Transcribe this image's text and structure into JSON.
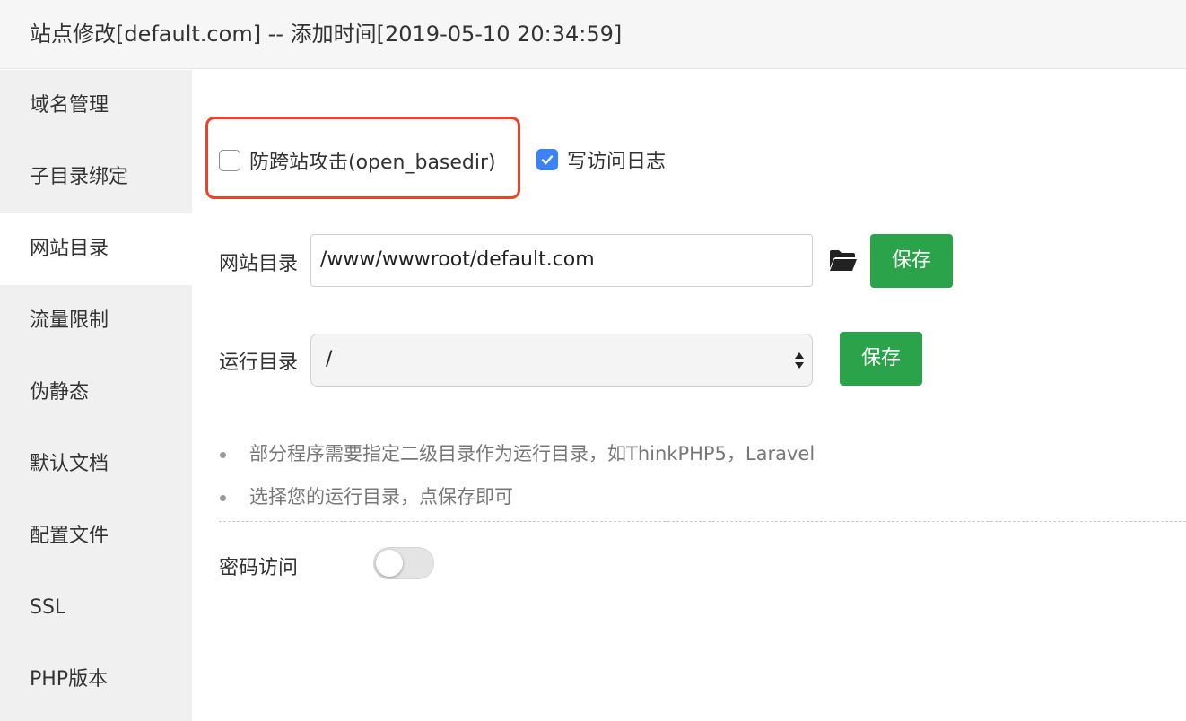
{
  "window": {
    "title": "站点修改[default.com] -- 添加时间[2019-05-10 20:34:59]"
  },
  "sidebar": {
    "items": [
      {
        "label": "域名管理"
      },
      {
        "label": "子目录绑定"
      },
      {
        "label": "网站目录",
        "active": true
      },
      {
        "label": "流量限制"
      },
      {
        "label": "伪静态"
      },
      {
        "label": "默认文档"
      },
      {
        "label": "配置文件"
      },
      {
        "label": "SSL"
      },
      {
        "label": "PHP版本"
      }
    ]
  },
  "main": {
    "anti_xss": {
      "label": "防跨站攻击(open_basedir)",
      "checked": false
    },
    "write_log": {
      "label": "写访问日志",
      "checked": true
    },
    "site_dir": {
      "label": "网站目录",
      "value": "/www/wwwroot/default.com",
      "icon": "folder-open-icon",
      "save_label": "保存"
    },
    "run_dir": {
      "label": "运行目录",
      "value": "/",
      "save_label": "保存"
    },
    "tips": [
      "部分程序需要指定二级目录作为运行目录，如ThinkPHP5，Laravel",
      "选择您的运行目录，点保存即可"
    ],
    "password_access": {
      "label": "密码访问",
      "enabled": false
    }
  },
  "colors": {
    "save_button": "#2ba34a",
    "checkbox_checked": "#3b82f6",
    "highlight_border": "#f0402a"
  }
}
